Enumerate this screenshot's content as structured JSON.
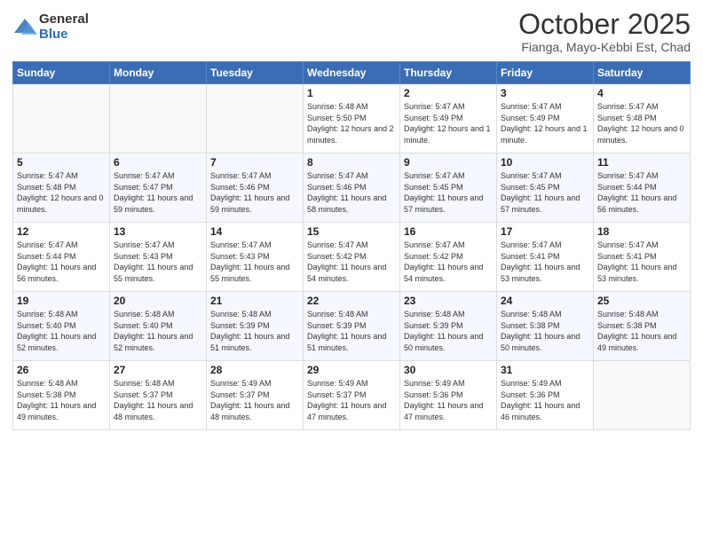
{
  "logo": {
    "general": "General",
    "blue": "Blue"
  },
  "title": "October 2025",
  "subtitle": "Fianga, Mayo-Kebbi Est, Chad",
  "days_of_week": [
    "Sunday",
    "Monday",
    "Tuesday",
    "Wednesday",
    "Thursday",
    "Friday",
    "Saturday"
  ],
  "weeks": [
    [
      {
        "day": "",
        "sunrise": "",
        "sunset": "",
        "daylight": ""
      },
      {
        "day": "",
        "sunrise": "",
        "sunset": "",
        "daylight": ""
      },
      {
        "day": "",
        "sunrise": "",
        "sunset": "",
        "daylight": ""
      },
      {
        "day": "1",
        "sunrise": "Sunrise: 5:48 AM",
        "sunset": "Sunset: 5:50 PM",
        "daylight": "Daylight: 12 hours and 2 minutes."
      },
      {
        "day": "2",
        "sunrise": "Sunrise: 5:47 AM",
        "sunset": "Sunset: 5:49 PM",
        "daylight": "Daylight: 12 hours and 1 minute."
      },
      {
        "day": "3",
        "sunrise": "Sunrise: 5:47 AM",
        "sunset": "Sunset: 5:49 PM",
        "daylight": "Daylight: 12 hours and 1 minute."
      },
      {
        "day": "4",
        "sunrise": "Sunrise: 5:47 AM",
        "sunset": "Sunset: 5:48 PM",
        "daylight": "Daylight: 12 hours and 0 minutes."
      }
    ],
    [
      {
        "day": "5",
        "sunrise": "Sunrise: 5:47 AM",
        "sunset": "Sunset: 5:48 PM",
        "daylight": "Daylight: 12 hours and 0 minutes."
      },
      {
        "day": "6",
        "sunrise": "Sunrise: 5:47 AM",
        "sunset": "Sunset: 5:47 PM",
        "daylight": "Daylight: 11 hours and 59 minutes."
      },
      {
        "day": "7",
        "sunrise": "Sunrise: 5:47 AM",
        "sunset": "Sunset: 5:46 PM",
        "daylight": "Daylight: 11 hours and 59 minutes."
      },
      {
        "day": "8",
        "sunrise": "Sunrise: 5:47 AM",
        "sunset": "Sunset: 5:46 PM",
        "daylight": "Daylight: 11 hours and 58 minutes."
      },
      {
        "day": "9",
        "sunrise": "Sunrise: 5:47 AM",
        "sunset": "Sunset: 5:45 PM",
        "daylight": "Daylight: 11 hours and 57 minutes."
      },
      {
        "day": "10",
        "sunrise": "Sunrise: 5:47 AM",
        "sunset": "Sunset: 5:45 PM",
        "daylight": "Daylight: 11 hours and 57 minutes."
      },
      {
        "day": "11",
        "sunrise": "Sunrise: 5:47 AM",
        "sunset": "Sunset: 5:44 PM",
        "daylight": "Daylight: 11 hours and 56 minutes."
      }
    ],
    [
      {
        "day": "12",
        "sunrise": "Sunrise: 5:47 AM",
        "sunset": "Sunset: 5:44 PM",
        "daylight": "Daylight: 11 hours and 56 minutes."
      },
      {
        "day": "13",
        "sunrise": "Sunrise: 5:47 AM",
        "sunset": "Sunset: 5:43 PM",
        "daylight": "Daylight: 11 hours and 55 minutes."
      },
      {
        "day": "14",
        "sunrise": "Sunrise: 5:47 AM",
        "sunset": "Sunset: 5:43 PM",
        "daylight": "Daylight: 11 hours and 55 minutes."
      },
      {
        "day": "15",
        "sunrise": "Sunrise: 5:47 AM",
        "sunset": "Sunset: 5:42 PM",
        "daylight": "Daylight: 11 hours and 54 minutes."
      },
      {
        "day": "16",
        "sunrise": "Sunrise: 5:47 AM",
        "sunset": "Sunset: 5:42 PM",
        "daylight": "Daylight: 11 hours and 54 minutes."
      },
      {
        "day": "17",
        "sunrise": "Sunrise: 5:47 AM",
        "sunset": "Sunset: 5:41 PM",
        "daylight": "Daylight: 11 hours and 53 minutes."
      },
      {
        "day": "18",
        "sunrise": "Sunrise: 5:47 AM",
        "sunset": "Sunset: 5:41 PM",
        "daylight": "Daylight: 11 hours and 53 minutes."
      }
    ],
    [
      {
        "day": "19",
        "sunrise": "Sunrise: 5:48 AM",
        "sunset": "Sunset: 5:40 PM",
        "daylight": "Daylight: 11 hours and 52 minutes."
      },
      {
        "day": "20",
        "sunrise": "Sunrise: 5:48 AM",
        "sunset": "Sunset: 5:40 PM",
        "daylight": "Daylight: 11 hours and 52 minutes."
      },
      {
        "day": "21",
        "sunrise": "Sunrise: 5:48 AM",
        "sunset": "Sunset: 5:39 PM",
        "daylight": "Daylight: 11 hours and 51 minutes."
      },
      {
        "day": "22",
        "sunrise": "Sunrise: 5:48 AM",
        "sunset": "Sunset: 5:39 PM",
        "daylight": "Daylight: 11 hours and 51 minutes."
      },
      {
        "day": "23",
        "sunrise": "Sunrise: 5:48 AM",
        "sunset": "Sunset: 5:39 PM",
        "daylight": "Daylight: 11 hours and 50 minutes."
      },
      {
        "day": "24",
        "sunrise": "Sunrise: 5:48 AM",
        "sunset": "Sunset: 5:38 PM",
        "daylight": "Daylight: 11 hours and 50 minutes."
      },
      {
        "day": "25",
        "sunrise": "Sunrise: 5:48 AM",
        "sunset": "Sunset: 5:38 PM",
        "daylight": "Daylight: 11 hours and 49 minutes."
      }
    ],
    [
      {
        "day": "26",
        "sunrise": "Sunrise: 5:48 AM",
        "sunset": "Sunset: 5:38 PM",
        "daylight": "Daylight: 11 hours and 49 minutes."
      },
      {
        "day": "27",
        "sunrise": "Sunrise: 5:48 AM",
        "sunset": "Sunset: 5:37 PM",
        "daylight": "Daylight: 11 hours and 48 minutes."
      },
      {
        "day": "28",
        "sunrise": "Sunrise: 5:49 AM",
        "sunset": "Sunset: 5:37 PM",
        "daylight": "Daylight: 11 hours and 48 minutes."
      },
      {
        "day": "29",
        "sunrise": "Sunrise: 5:49 AM",
        "sunset": "Sunset: 5:37 PM",
        "daylight": "Daylight: 11 hours and 47 minutes."
      },
      {
        "day": "30",
        "sunrise": "Sunrise: 5:49 AM",
        "sunset": "Sunset: 5:36 PM",
        "daylight": "Daylight: 11 hours and 47 minutes."
      },
      {
        "day": "31",
        "sunrise": "Sunrise: 5:49 AM",
        "sunset": "Sunset: 5:36 PM",
        "daylight": "Daylight: 11 hours and 46 minutes."
      },
      {
        "day": "",
        "sunrise": "",
        "sunset": "",
        "daylight": ""
      }
    ]
  ]
}
